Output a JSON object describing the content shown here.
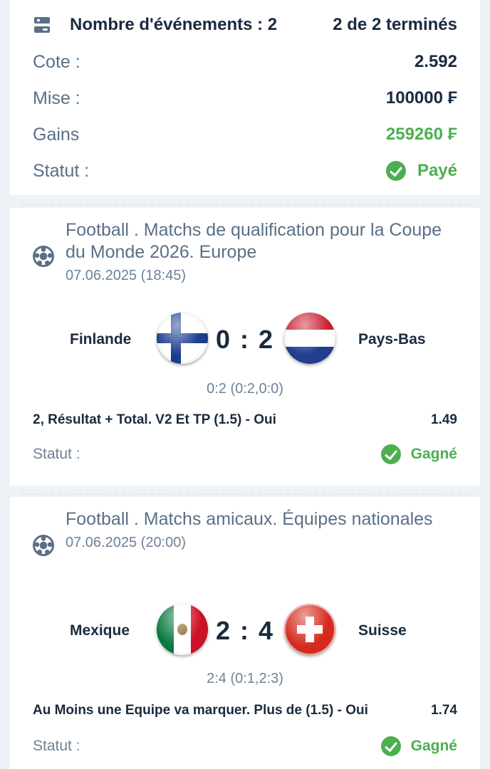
{
  "summary": {
    "events_label": "Nombre d'événements : 2",
    "events_done": "2 de 2 terminés",
    "odds_label": "Cote :",
    "odds_value": "2.592",
    "stake_label": "Mise :",
    "stake_value": "100000 ₣",
    "winnings_label": "Gains",
    "winnings_value": "259260 ₣",
    "status_label": "Statut :",
    "status_value": "Payé",
    "colors": {
      "green": "#4caf50",
      "dark": "#1a2a3f",
      "muted": "#5a6f86"
    }
  },
  "events": [
    {
      "icon": "football-icon",
      "title": "Football . Matchs de qualification pour la Coupe du Monde 2026. Europe",
      "date": "07.06.2025 (18:45)",
      "home": "Finlande",
      "home_flag": "finland-flag",
      "score": "0 : 2",
      "away": "Pays-Bas",
      "away_flag": "netherlands-flag",
      "detail": "0:2 (0:2,0:0)",
      "bet": "2, Résultat + Total. V2 Et TP (1.5) - Oui",
      "odds": "1.49",
      "status_label": "Statut :",
      "status_value": "Gagné"
    },
    {
      "icon": "football-icon",
      "title": "Football . Matchs amicaux. Équipes nationales",
      "date": "07.06.2025 (20:00)",
      "home": "Mexique",
      "home_flag": "mexico-flag",
      "score": "2 : 4",
      "away": "Suisse",
      "away_flag": "switzerland-flag",
      "detail": "2:4 (0:1,2:3)",
      "bet": "Au Moins une Equipe va marquer. Plus de (1.5) - Oui",
      "odds": "1.74",
      "status_label": "Statut :",
      "status_value": "Gagné"
    }
  ]
}
